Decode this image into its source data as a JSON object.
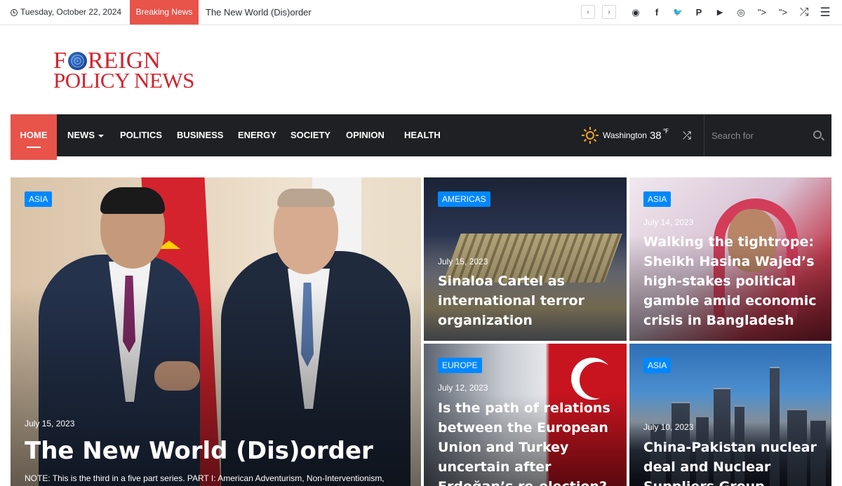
{
  "topbar": {
    "date": "Tuesday, October 22, 2024",
    "breaking_label": "Breaking News",
    "breaking_title": "The New World (Dis)order",
    "prev_arrow": "‹",
    "next_arrow": "›",
    "social": [
      {
        "name": "rss-icon",
        "glyph": "◉"
      },
      {
        "name": "facebook-icon",
        "glyph": "f"
      },
      {
        "name": "twitter-icon",
        "glyph": "🐦"
      },
      {
        "name": "pinterest-icon",
        "glyph": "P"
      },
      {
        "name": "youtube-icon",
        "glyph": "▶"
      },
      {
        "name": "instagram-icon",
        "glyph": "◎"
      }
    ],
    "stray_text_1": "\">",
    "stray_text_2": "\">",
    "shuffle_glyph": "⤮",
    "menu_glyph": "☰"
  },
  "logo": {
    "line1_letter": "F",
    "line1_rest": "REIGN",
    "line2": "POLICY NEWS"
  },
  "nav": {
    "items": [
      "Home",
      "News",
      "Politics",
      "Business",
      "Energy",
      "Society",
      "Opinion",
      "Health"
    ],
    "weather_city": "Washington",
    "weather_temp": "38",
    "weather_unit": "℉",
    "shuffle_glyph": "⤮",
    "search_placeholder": "Search for"
  },
  "posts": {
    "main": {
      "category": "Asia",
      "date": "July 15, 2023",
      "title": "The New World (Dis)order",
      "excerpt": "NOTE: This is the third in a five part series. PART I: American Adventurism, Non-Interventionism,"
    },
    "p1": {
      "category": "Americas",
      "date": "July 15, 2023",
      "title_lines": [
        "Sinaloa Cartel as",
        "international terror",
        "organization"
      ]
    },
    "p2": {
      "category": "Asia",
      "date": "July 14, 2023",
      "title_lines": [
        "Walking the tightrope:",
        "Sheikh Hasina Wajed’s",
        "high-stakes political",
        "gamble amid economic",
        "crisis in Bangladesh"
      ]
    },
    "p3": {
      "category": "Europe",
      "date": "July 12, 2023",
      "title_lines": [
        "Is the path of relations",
        "between the European",
        "Union and Turkey",
        "uncertain after",
        "Erdoğan’s re-election?"
      ]
    },
    "p4": {
      "category": "Asia",
      "date": "July 10, 2023",
      "title_lines": [
        "China-Pakistan nuclear",
        "deal and Nuclear",
        "Suppliers Group"
      ]
    }
  },
  "colors": {
    "accent": "#e8534a",
    "nav_bg": "#1f2024",
    "category_blue": "#0088ff",
    "logo_red": "#d4232d"
  }
}
